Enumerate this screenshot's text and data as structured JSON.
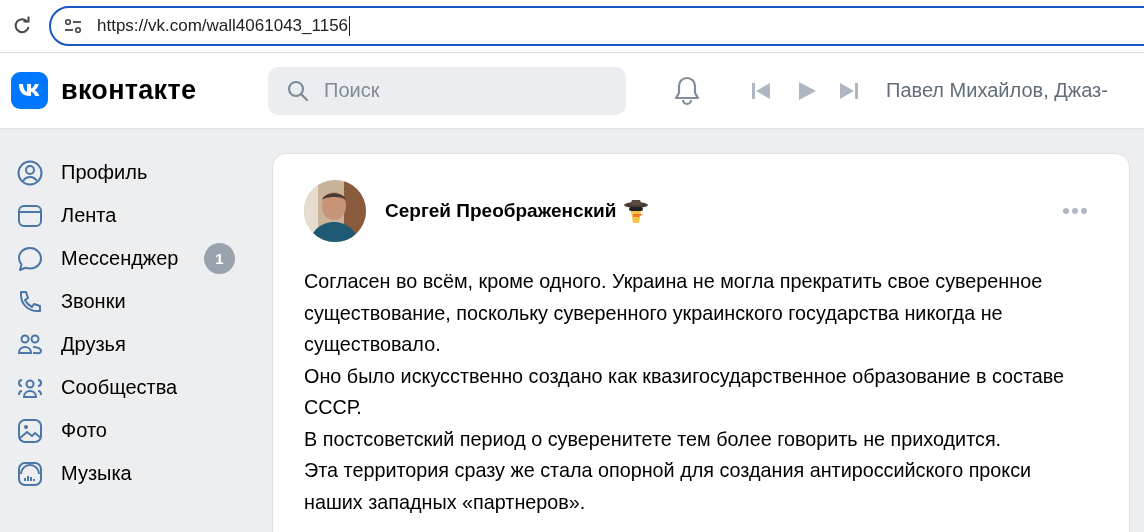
{
  "browser": {
    "url": "https://vk.com/wall4061043_1156"
  },
  "header": {
    "logo_text": "вконтакте",
    "search": {
      "placeholder": "Поиск"
    },
    "player": {
      "track": "Павел Михайлов, Джаз-"
    }
  },
  "sidebar": {
    "items": [
      {
        "label": "Профиль"
      },
      {
        "label": "Лента"
      },
      {
        "label": "Мессенджер",
        "badge": "1"
      },
      {
        "label": "Звонки"
      },
      {
        "label": "Друзья"
      },
      {
        "label": "Сообщества"
      },
      {
        "label": "Фото"
      },
      {
        "label": "Музыка"
      }
    ]
  },
  "post": {
    "author": "Сергей Преображенский",
    "paragraphs": [
      "Согласен во всём, кроме одного. Украина не могла прекратить свое суверенное существование, поскольку суверенного украинского государства никогда не существовало.",
      "Оно было искусственно создано как квазигосударственное образование в составе СССР.",
      "В постсоветский период о суверенитете тем более говорить не приходится.",
      "Эта территория сразу же стала опорной для создания антироссийского прокси наших западных «партнеров»."
    ]
  }
}
